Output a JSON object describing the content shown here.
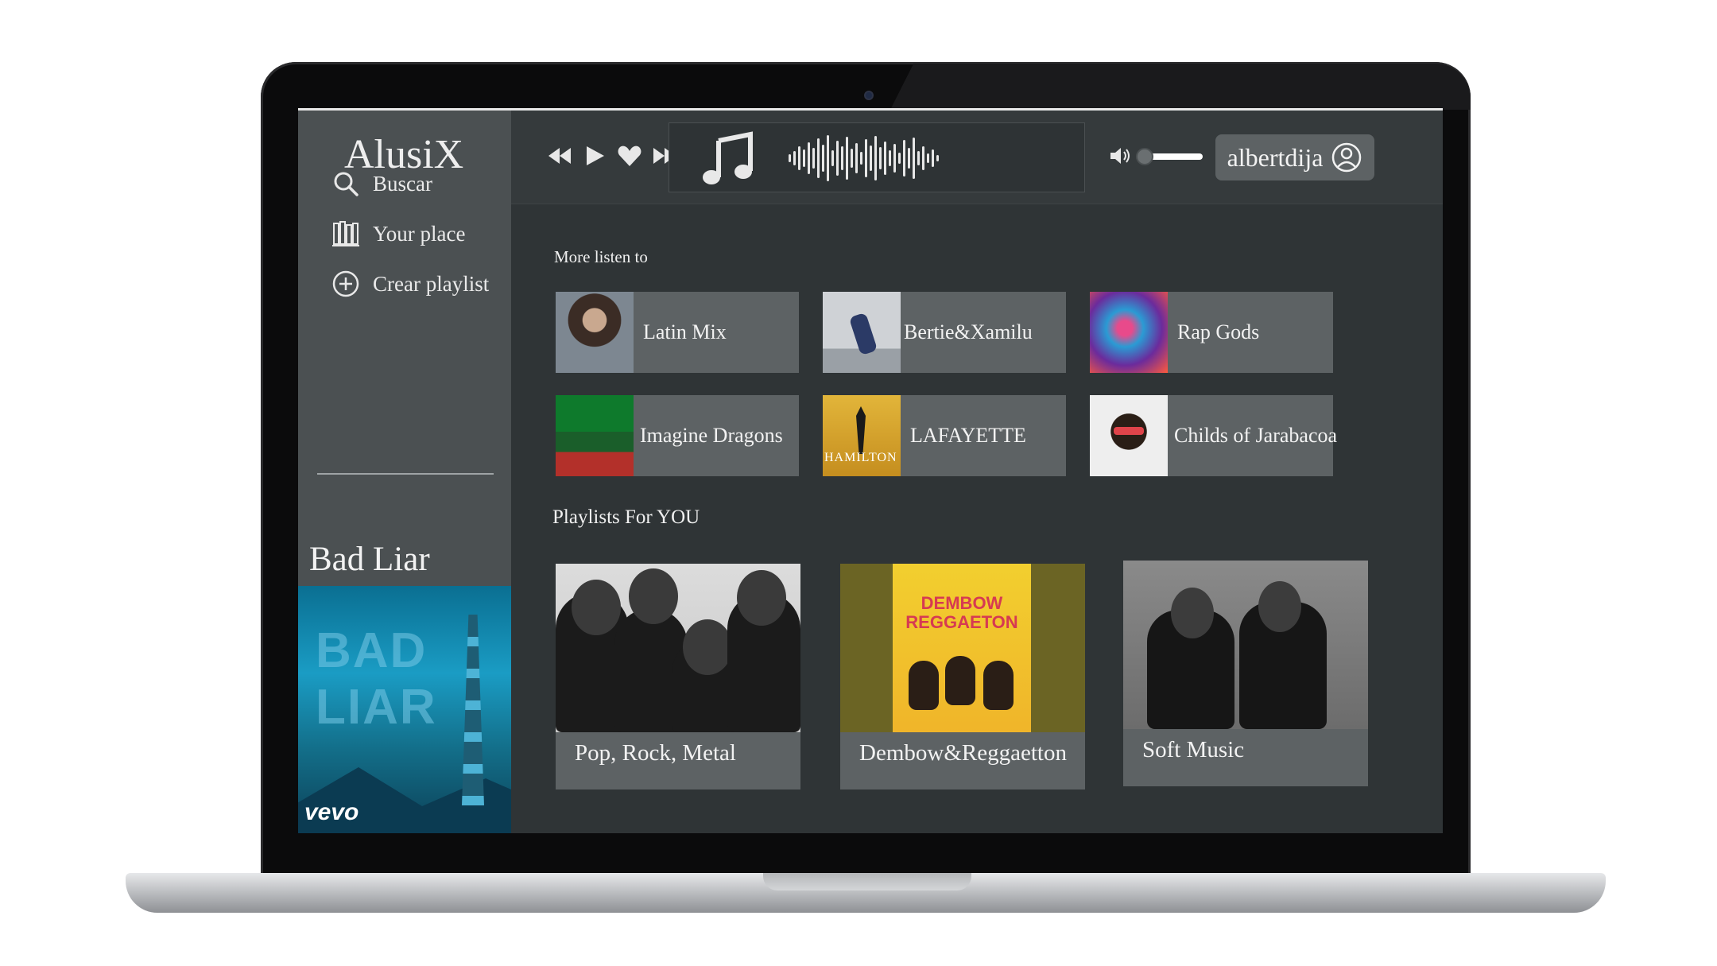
{
  "app": {
    "brand": "AlusiX"
  },
  "sidebar": {
    "items": [
      {
        "label": "Buscar",
        "icon": "search-icon"
      },
      {
        "label": "Your place",
        "icon": "library-icon"
      },
      {
        "label": "Crear playlist",
        "icon": "plus-circle-icon"
      }
    ],
    "now_playing": {
      "title": "Bad Liar",
      "art_text": "BAD LIAR",
      "art_brand": "vevo"
    }
  },
  "topbar": {
    "controls": [
      "rewind-icon",
      "play-icon",
      "heart-icon",
      "fast-forward-icon"
    ],
    "volume_level": 0.05,
    "username": "albertdija"
  },
  "main": {
    "more_listen_title": "More listen to",
    "more_listen": [
      {
        "label": "Latin Mix"
      },
      {
        "label": "Bertie&Xamilu"
      },
      {
        "label": "Rap Gods"
      },
      {
        "label": "Imagine Dragons"
      },
      {
        "label": "LAFAYETTE",
        "thumb_text": "HAMILTON"
      },
      {
        "label": "Childs of Jarabacoa"
      }
    ],
    "playlists_title": "Playlists For YOU",
    "playlists": [
      {
        "label": "Pop, Rock, Metal"
      },
      {
        "label": "Dembow&Reggaetton",
        "cover_text_1": "DEMBOW",
        "cover_text_2": "REGGAETON"
      },
      {
        "label": "Soft Music"
      }
    ]
  },
  "colors": {
    "background": "#2f3436",
    "sidebar": "#4b5052",
    "card": "#5d6264",
    "text": "#f2f2f2"
  }
}
